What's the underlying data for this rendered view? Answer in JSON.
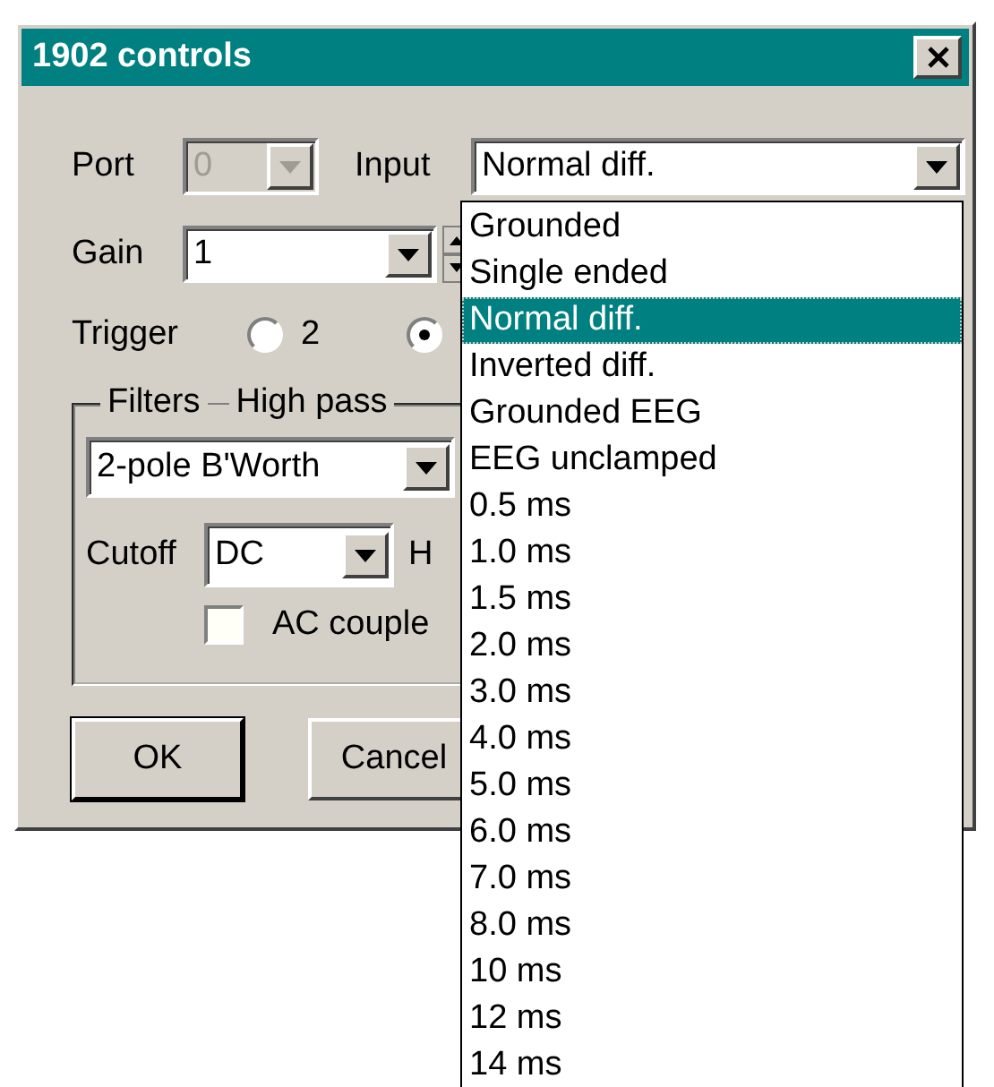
{
  "window": {
    "title": "1902 controls"
  },
  "port": {
    "label": "Port",
    "value": "0",
    "disabled": true
  },
  "input": {
    "label": "Input",
    "value": "Normal diff.",
    "expanded": true,
    "options": [
      {
        "label": "Grounded",
        "selected": false
      },
      {
        "label": "Single ended",
        "selected": false
      },
      {
        "label": "Normal diff.",
        "selected": true
      },
      {
        "label": "Inverted diff.",
        "selected": false
      },
      {
        "label": "Grounded EEG",
        "selected": false
      },
      {
        "label": "EEG unclamped",
        "selected": false
      },
      {
        "label": "0.5 ms",
        "selected": false
      },
      {
        "label": "1.0 ms",
        "selected": false
      },
      {
        "label": "1.5 ms",
        "selected": false
      },
      {
        "label": "2.0 ms",
        "selected": false
      },
      {
        "label": "3.0 ms",
        "selected": false
      },
      {
        "label": "4.0 ms",
        "selected": false
      },
      {
        "label": "5.0 ms",
        "selected": false
      },
      {
        "label": "6.0 ms",
        "selected": false
      },
      {
        "label": "7.0 ms",
        "selected": false
      },
      {
        "label": "8.0 ms",
        "selected": false
      },
      {
        "label": "10 ms",
        "selected": false
      },
      {
        "label": "12 ms",
        "selected": false
      },
      {
        "label": "14 ms",
        "selected": false
      }
    ]
  },
  "gain": {
    "label": "Gain",
    "value": "1"
  },
  "trigger": {
    "label": "Trigger",
    "options": [
      {
        "label": "2",
        "selected": false
      },
      {
        "selected": true
      }
    ]
  },
  "filters": {
    "title": "Filters",
    "subtitle": "High pass",
    "type": "2-pole B'Worth",
    "cutoff_label": "Cutoff",
    "cutoff": "DC",
    "unit": "H",
    "ac_couple": {
      "label": "AC couple",
      "checked": false
    }
  },
  "buttons": [
    {
      "label": "OK",
      "default": true
    },
    {
      "label": "Cancel",
      "default": false
    }
  ]
}
